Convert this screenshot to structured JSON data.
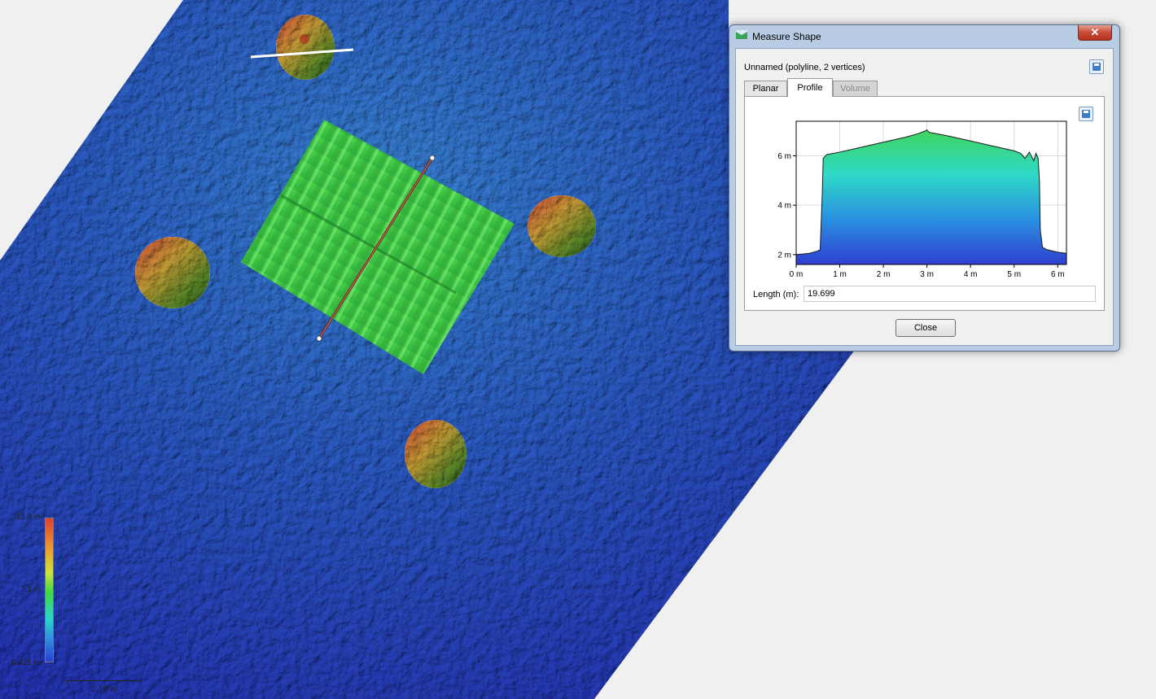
{
  "legend": {
    "max_label": "13.8 m",
    "mid_label": "7.1 m",
    "min_label": "0.421 m",
    "scale_label": "2.18 m"
  },
  "dialog": {
    "title": "Measure Shape",
    "close_glyph": "✕",
    "shape_name": "Unnamed (polyline, 2 vertices)",
    "tabs": [
      {
        "label": "Planar",
        "state": "normal"
      },
      {
        "label": "Profile",
        "state": "selected"
      },
      {
        "label": "Volume",
        "state": "disabled"
      }
    ],
    "length_label": "Length (m):",
    "length_value": "19.699",
    "close_label": "Close",
    "save_icon": "floppy-disk-icon"
  },
  "chart_data": {
    "type": "area",
    "xlabel": "",
    "ylabel": "",
    "xlim": [
      0,
      6.2
    ],
    "ylim": [
      1.6,
      7.4
    ],
    "x_ticks": [
      0,
      1,
      2,
      3,
      4,
      5,
      6
    ],
    "x_tick_labels": [
      "0 m",
      "1 m",
      "2 m",
      "3 m",
      "4 m",
      "5 m",
      "6 m"
    ],
    "y_ticks": [
      2,
      4,
      6
    ],
    "y_tick_labels": [
      "2 m",
      "4 m",
      "6 m"
    ],
    "grid": true,
    "series": [
      {
        "x": [
          0,
          0.3,
          0.5,
          0.55,
          0.6,
          0.62,
          0.7,
          1.0,
          1.5,
          2.0,
          2.5,
          2.8,
          2.95,
          3.0,
          3.05,
          3.2,
          3.5,
          4.0,
          4.5,
          5.0,
          5.15,
          5.25,
          5.35,
          5.45,
          5.5,
          5.55,
          5.58,
          5.6,
          5.65,
          5.75,
          6.0,
          6.2
        ],
        "y": [
          2.0,
          2.05,
          2.15,
          2.2,
          4.5,
          5.9,
          6.05,
          6.15,
          6.35,
          6.55,
          6.75,
          6.9,
          7.0,
          7.05,
          6.95,
          6.9,
          6.8,
          6.6,
          6.4,
          6.2,
          6.1,
          5.9,
          6.15,
          5.8,
          6.1,
          5.9,
          5.0,
          3.0,
          2.3,
          2.2,
          2.1,
          2.05
        ],
        "gradient_colors": [
          "#3fd45c",
          "#2ed9c8",
          "#2a8fe0",
          "#2f3fd0"
        ]
      }
    ]
  }
}
